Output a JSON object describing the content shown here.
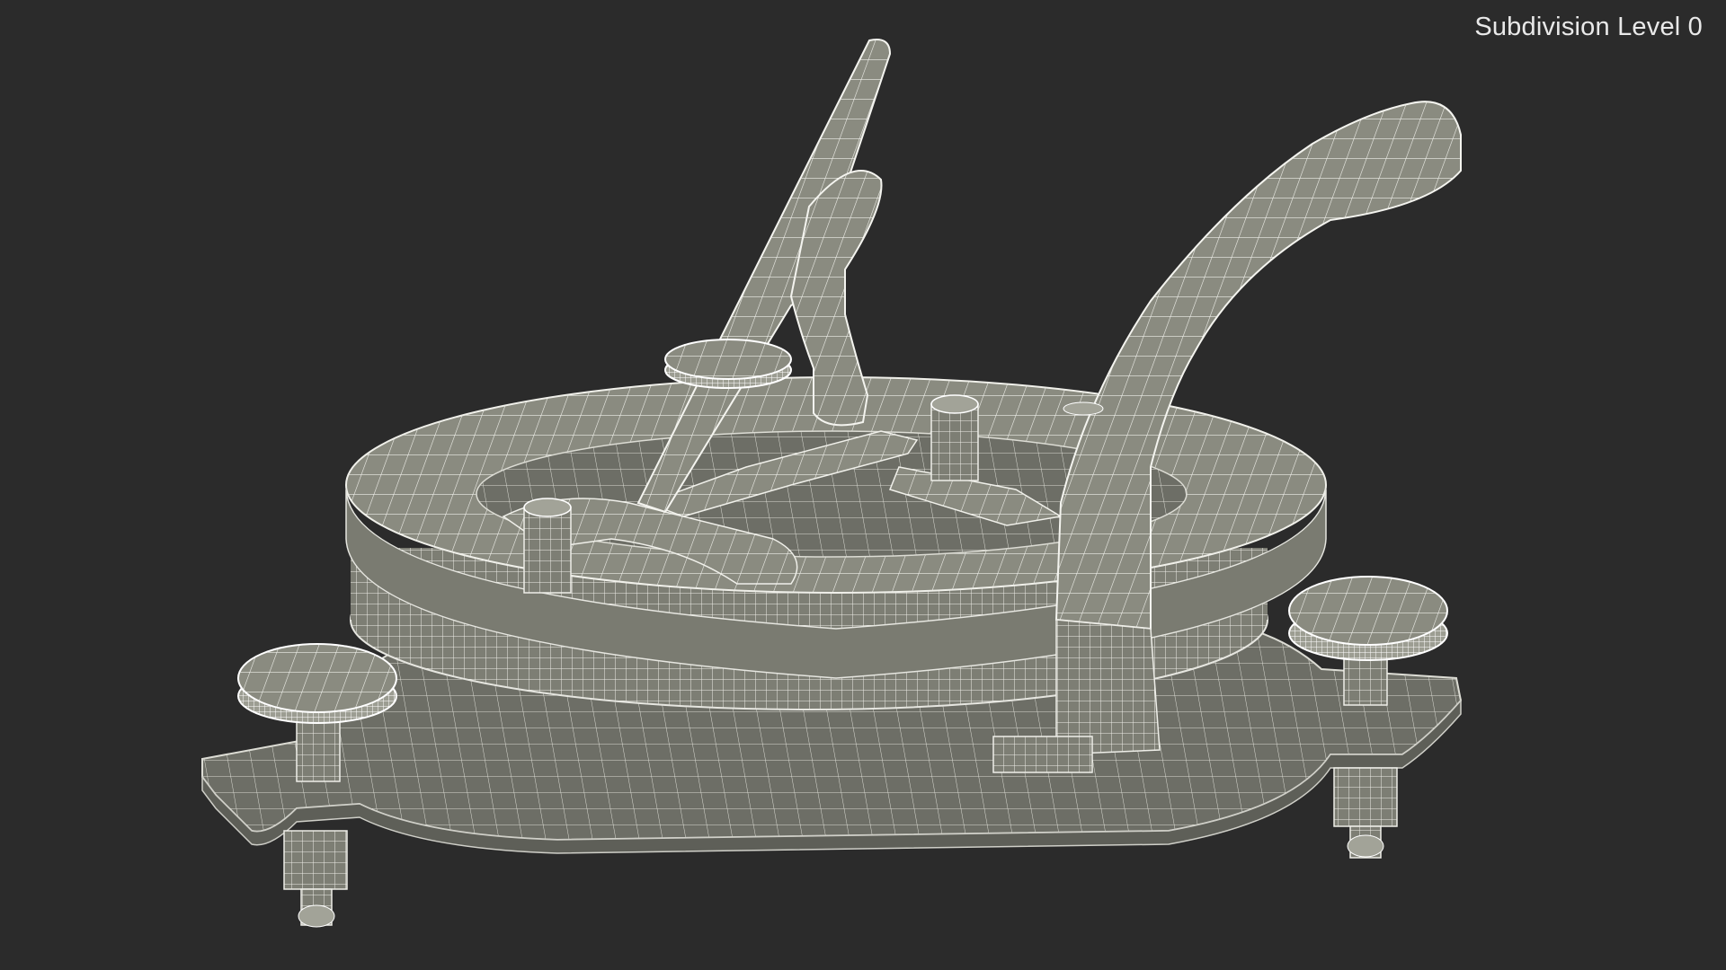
{
  "viewport": {
    "background_color": "#2b2b2b",
    "subdivision_label": "Subdivision Level 0"
  },
  "model": {
    "render_style": "wireframe-on-shaded",
    "surface_color": "#8a8b80",
    "wire_color": "#ffffff",
    "shadow_color": "#55564f",
    "parts": [
      "base-plate",
      "dial-ring",
      "gnomon-arm-left",
      "curved-arm-right",
      "leveling-screw-front-left",
      "leveling-screw-right",
      "leveling-screw-back",
      "pin-left",
      "pin-center"
    ]
  }
}
